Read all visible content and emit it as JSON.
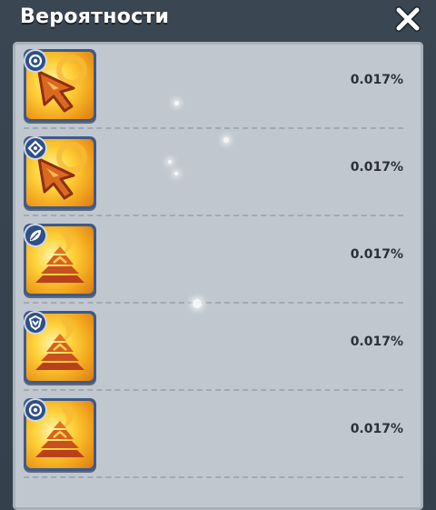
{
  "window": {
    "title": "Вероятности",
    "close_icon": "close-icon"
  },
  "drops": [
    {
      "percent": "0.017%",
      "badge_icon": "swirl-badge-icon",
      "art_icon": "arrow-cursor-icon"
    },
    {
      "percent": "0.017%",
      "badge_icon": "diamond-badge-icon",
      "art_icon": "arrow-cursor-icon"
    },
    {
      "percent": "0.017%",
      "badge_icon": "leaf-badge-icon",
      "art_icon": "pyramid-icon"
    },
    {
      "percent": "0.017%",
      "badge_icon": "shield-badge-icon",
      "art_icon": "pyramid-icon"
    },
    {
      "percent": "0.017%",
      "badge_icon": "swirl-badge-icon",
      "art_icon": "pyramid-icon"
    }
  ],
  "colors": {
    "header_bg": "#3a4652",
    "panel_bg": "#c0c7cf",
    "icon_frame": "#3e5a8a",
    "icon_gold": "#ffd23a",
    "icon_art": "#b8401a",
    "text": "#2a3038"
  }
}
